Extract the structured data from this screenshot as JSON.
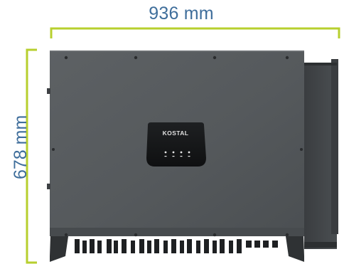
{
  "dimensions": {
    "width_text": "936 mm",
    "height_text": "678 mm"
  },
  "device": {
    "brand_text": "KOSTAL"
  },
  "colors": {
    "dimension_line": "#b7cf2e",
    "dimension_text": "#3f6e9b",
    "housing": "#55595c",
    "housing_dark": "#323537",
    "display_panel": "#141517",
    "led": "#e8e8e8"
  }
}
